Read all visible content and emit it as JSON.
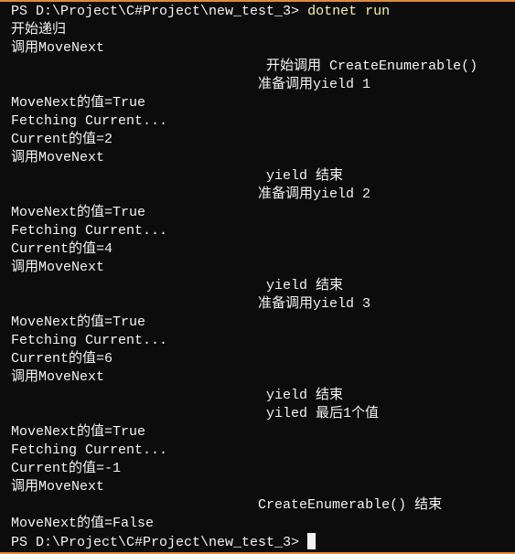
{
  "terminal": {
    "prompt": "PS D:\\Project\\C#Project\\new_test_3> ",
    "command": "dotnet run",
    "colors": {
      "background": "#0c0c0c",
      "text": "#f2f2f2",
      "command": "#f9f1a5",
      "border": "#e08a3c"
    },
    "output": [
      "开始递归",
      "调用MoveNext",
      "                               开始调用 CreateEnumerable()",
      "                              准备调用yield 1",
      "MoveNext的值=True",
      "Fetching Current...",
      "Current的值=2",
      "调用MoveNext",
      "                               yield 结束",
      "                              准备调用yield 2",
      "MoveNext的值=True",
      "Fetching Current...",
      "Current的值=4",
      "调用MoveNext",
      "                               yield 结束",
      "                              准备调用yield 3",
      "MoveNext的值=True",
      "Fetching Current...",
      "Current的值=6",
      "调用MoveNext",
      "                               yield 结束",
      "                               yiled 最后1个值",
      "MoveNext的值=True",
      "Fetching Current...",
      "Current的值=-1",
      "调用MoveNext",
      "                              CreateEnumerable() 结束",
      "MoveNext的值=False"
    ]
  }
}
